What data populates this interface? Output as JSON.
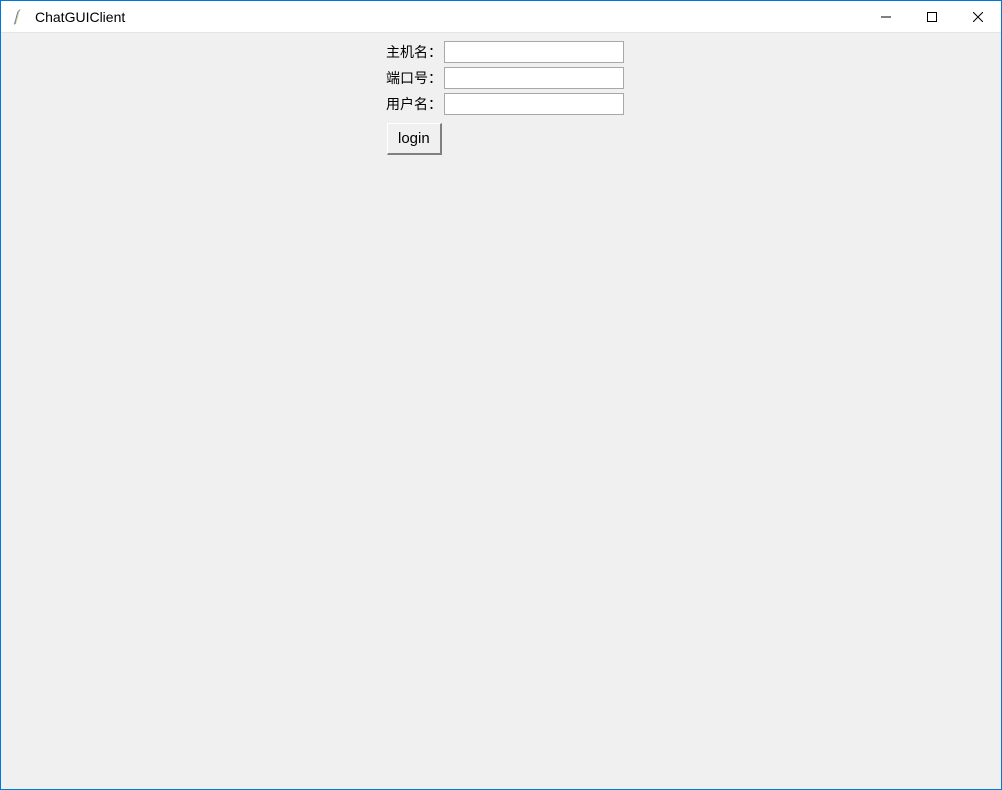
{
  "window": {
    "title": "ChatGUIClient"
  },
  "form": {
    "hostname_label": "主机名：",
    "hostname_value": "",
    "port_label": "端口号：",
    "port_value": "",
    "username_label": "用户名：",
    "username_value": "",
    "login_button_label": "login"
  }
}
